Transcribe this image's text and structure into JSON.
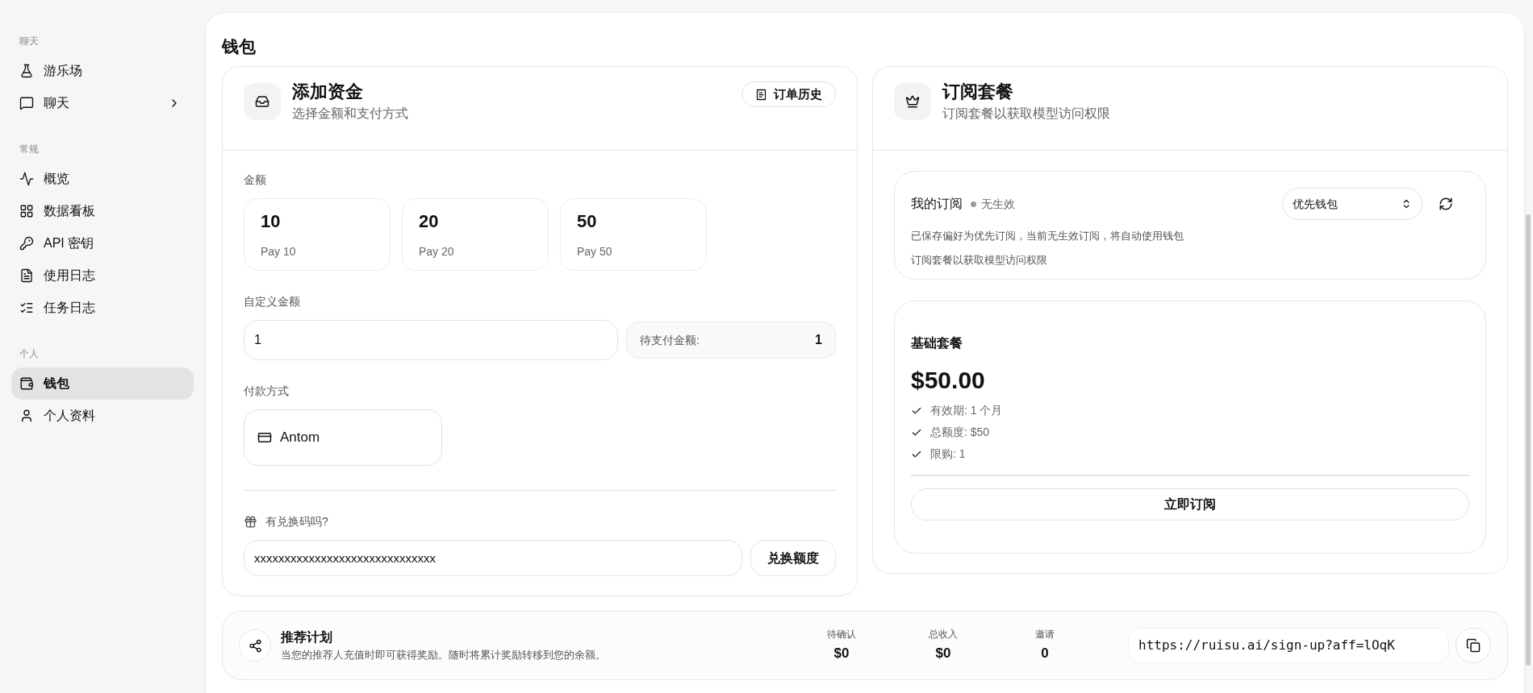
{
  "sidebar": {
    "sections": [
      {
        "title": "聊天",
        "items": [
          {
            "label": "游乐场",
            "expandable": false,
            "selected": false
          },
          {
            "label": "聊天",
            "expandable": true,
            "selected": false
          }
        ]
      },
      {
        "title": "常规",
        "items": [
          {
            "label": "概览",
            "expandable": false,
            "selected": false
          },
          {
            "label": "数据看板",
            "expandable": false,
            "selected": false
          },
          {
            "label": "API 密钥",
            "expandable": false,
            "selected": false
          },
          {
            "label": "使用日志",
            "expandable": false,
            "selected": false
          },
          {
            "label": "任务日志",
            "expandable": false,
            "selected": false
          }
        ]
      },
      {
        "title": "个人",
        "items": [
          {
            "label": "钱包",
            "expandable": false,
            "selected": true
          },
          {
            "label": "个人资料",
            "expandable": false,
            "selected": false
          }
        ]
      }
    ]
  },
  "page_title": "钱包",
  "add_funds": {
    "title": "添加资金",
    "subtitle": "选择金额和支付方式",
    "history_button": "订单历史",
    "amount_label": "金额",
    "presets": [
      {
        "amount": "10",
        "caption": "Pay 10",
        "selected": false
      },
      {
        "amount": "20",
        "caption": "Pay 20",
        "selected": false
      },
      {
        "amount": "50",
        "caption": "Pay 50",
        "selected": false
      }
    ],
    "custom_label": "自定义金额",
    "custom_value": "1",
    "due_label": "待支付金额:",
    "due_value": "1",
    "payment_label": "付款方式",
    "payment_methods": [
      {
        "name": "Antom",
        "selected": false
      }
    ],
    "redeem_label": "有兑换码吗?",
    "redeem_value": "xxxxxxxxxxxxxxxxxxxxxxxxxxxxxx",
    "redeem_button": "兑换额度"
  },
  "subscription": {
    "title": "订阅套餐",
    "subtitle": "订阅套餐以获取模型访问权限",
    "mine": {
      "title": "我的订阅",
      "status": "无生效",
      "preference": "优先钱包",
      "notes": [
        "已保存偏好为优先订阅，当前无生效订阅，将自动使用钱包",
        "订阅套餐以获取模型访问权限"
      ]
    },
    "plans": [
      {
        "name": "基础套餐",
        "price": "$50.00",
        "features": [
          "有效期: 1 个月",
          "总额度: $50",
          "限购: 1"
        ],
        "button": "立即订阅"
      }
    ]
  },
  "referral": {
    "title": "推荐计划",
    "description": "当您的推荐人充值时即可获得奖励。随时将累计奖励转移到您的余额。",
    "stats": [
      {
        "label": "待确认",
        "value": "$0"
      },
      {
        "label": "总收入",
        "value": "$0"
      },
      {
        "label": "邀请",
        "value": "0"
      }
    ],
    "link": "https://ruisu.ai/sign-up?aff=lOqK"
  }
}
